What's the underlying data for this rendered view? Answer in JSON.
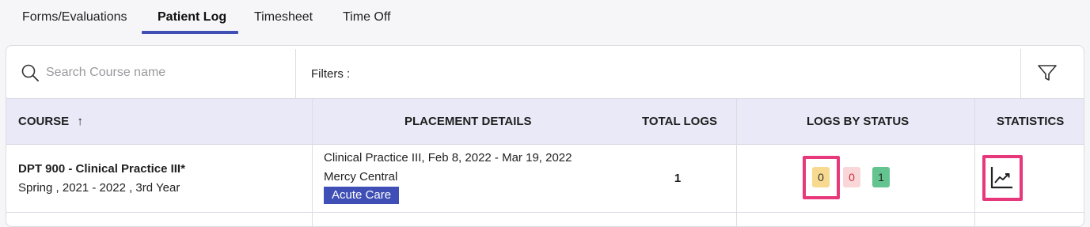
{
  "tabs": [
    {
      "label": "Forms/Evaluations",
      "active": false
    },
    {
      "label": "Patient Log",
      "active": true
    },
    {
      "label": "Timesheet",
      "active": false
    },
    {
      "label": "Time Off",
      "active": false
    }
  ],
  "toolbar": {
    "search_placeholder": "Search Course name",
    "filters_label": "Filters :",
    "search_icon": "search-icon",
    "filter_icon": "filter-icon"
  },
  "table": {
    "headers": {
      "course": "COURSE",
      "course_sort": "↑",
      "placement_details": "PLACEMENT DETAILS",
      "total_logs": "TOTAL LOGS",
      "logs_by_status": "LOGS BY STATUS",
      "statistics": "STATISTICS"
    },
    "rows": [
      {
        "course_name": "DPT 900 - Clinical Practice III*",
        "course_term": "Spring , 2021 - 2022 , 3rd Year",
        "placement_line1": "Clinical Practice III, Feb 8, 2022 - Mar 19, 2022",
        "placement_line2": "Mercy Central",
        "placement_tag": "Acute Care",
        "total_logs": "1",
        "status_pending": "0",
        "status_rejected": "0",
        "status_approved": "1",
        "statistics_icon": "trending-chart-icon"
      }
    ]
  },
  "colors": {
    "accent": "#3f4fb5",
    "header_bg": "#e9e9f8",
    "pending": "#f7d98f",
    "rejected": "#f9d6d8",
    "approved": "#63c48f",
    "highlight": "#e6387a"
  }
}
